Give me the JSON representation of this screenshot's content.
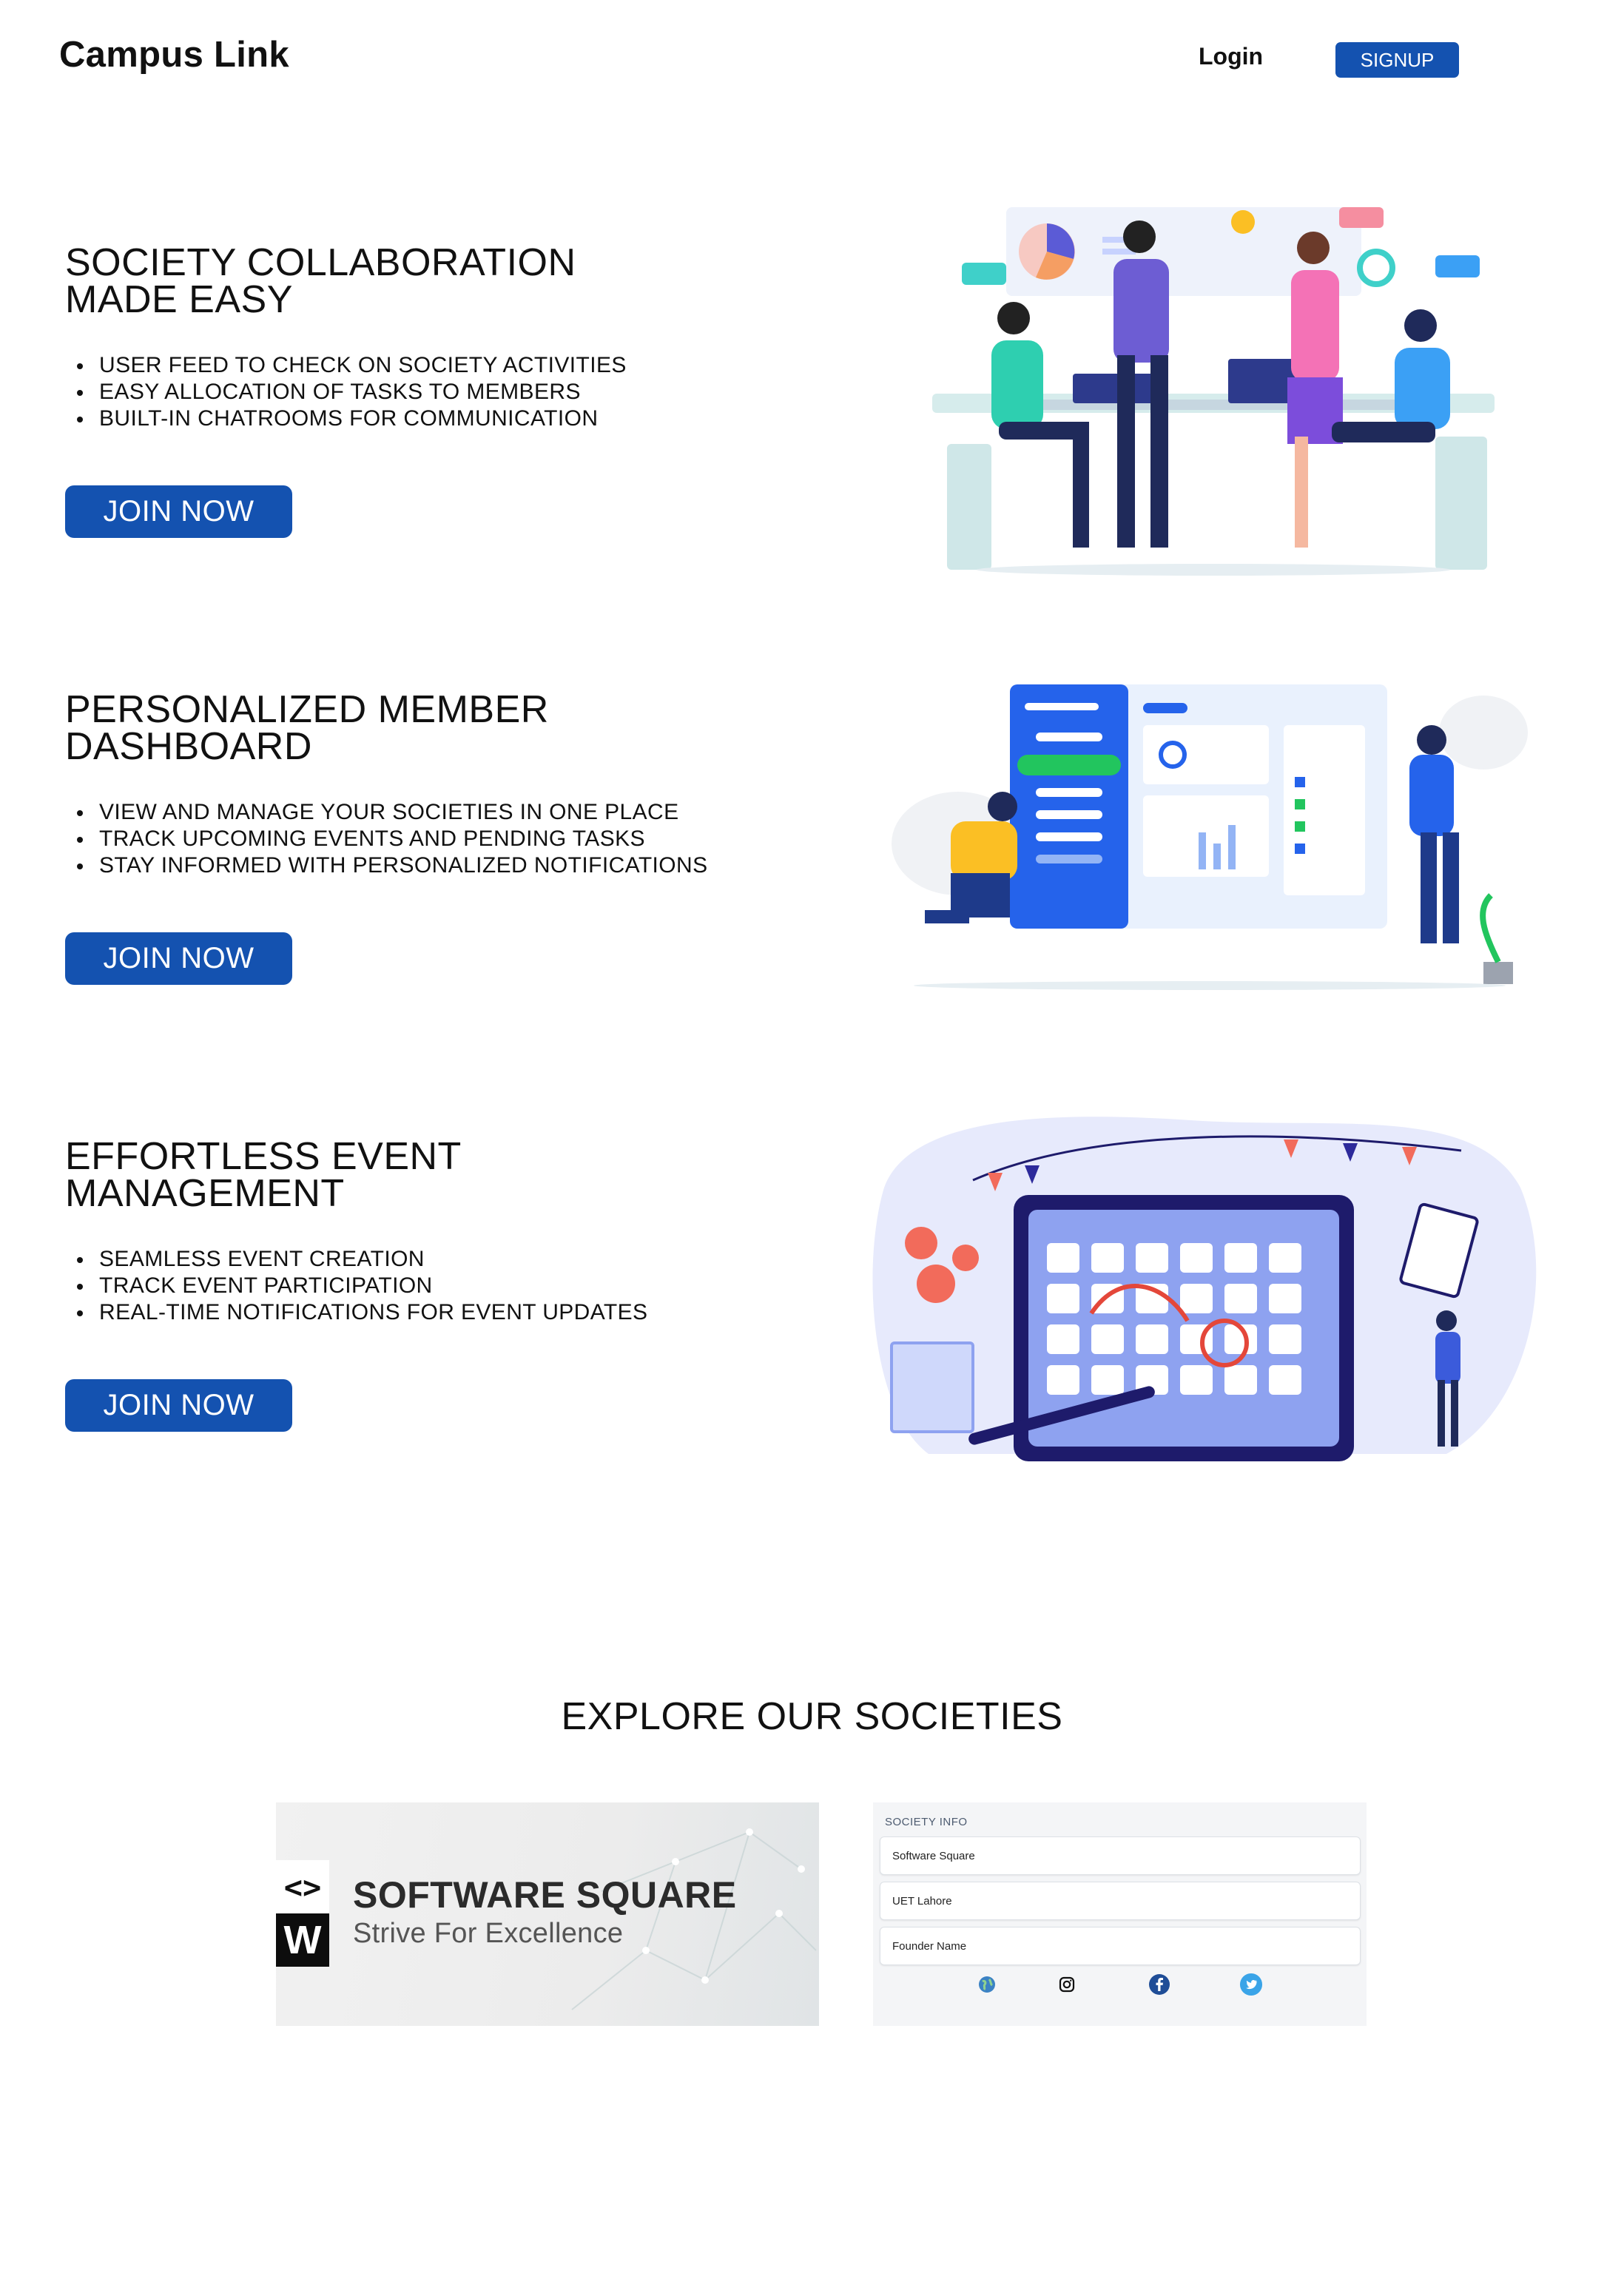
{
  "header": {
    "brand": "Campus Link",
    "login_label": "Login",
    "signup_label": "SIGNUP"
  },
  "features": [
    {
      "title": "SOCIETY COLLABORATION MADE EASY",
      "items": [
        "USER FEED TO CHECK ON SOCIETY ACTIVITIES",
        "EASY ALLOCATION OF TASKS TO MEMBERS",
        "BUILT-IN CHATROOMS FOR COMMUNICATION"
      ],
      "button": "JOIN NOW"
    },
    {
      "title": "PERSONALIZED MEMBER DASHBOARD",
      "items": [
        "VIEW AND MANAGE YOUR SOCIETIES IN ONE PLACE",
        "TRACK UPCOMING EVENTS AND PENDING TASKS",
        "STAY INFORMED WITH PERSONALIZED NOTIFICATIONS"
      ],
      "button": "JOIN NOW"
    },
    {
      "title": "EFFORTLESS EVENT MANAGEMENT",
      "items": [
        "SEAMLESS EVENT CREATION",
        "TRACK EVENT PARTICIPATION",
        "REAL-TIME NOTIFICATIONS FOR EVENT UPDATES"
      ],
      "button": "JOIN NOW"
    }
  ],
  "explore": {
    "title": "EXPLORE OUR SOCIETIES",
    "banner": {
      "logo_top": "<>",
      "logo_bottom": "W",
      "name": "SOFTWARE SQUARE",
      "tagline": "Strive For Excellence"
    },
    "info": {
      "heading": "SOCIETY INFO",
      "fields": [
        "Software Square",
        "UET Lahore",
        "Founder Name"
      ],
      "icons": [
        "globe-icon",
        "instagram-icon",
        "facebook-icon",
        "twitter-icon"
      ]
    }
  },
  "colors": {
    "primary": "#1452b0",
    "accent_blue": "#2563eb",
    "indigo": "#3730a3"
  }
}
